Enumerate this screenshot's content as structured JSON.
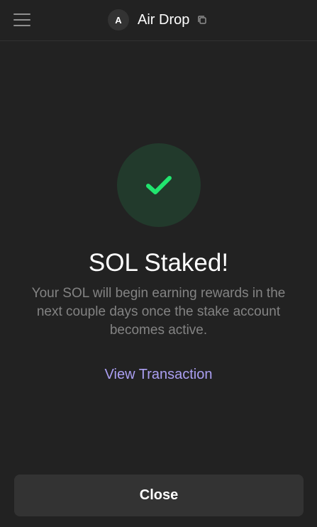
{
  "header": {
    "avatar_letter": "A",
    "account_name": "Air Drop"
  },
  "icons": {
    "menu": "hamburger-menu-icon",
    "copy": "copy-icon",
    "status": "checkmark-icon"
  },
  "colors": {
    "background": "#222222",
    "success_green": "#21e56f",
    "success_circle_bg": "#223a2c",
    "link_purple": "#ab9ff2",
    "muted_text": "#838383",
    "button_bg": "#333333"
  },
  "main": {
    "title": "SOL Staked!",
    "message": "Your SOL will begin earning rewards in the next couple days once the stake account becomes active.",
    "link_label": "View Transaction"
  },
  "footer": {
    "close_label": "Close"
  }
}
